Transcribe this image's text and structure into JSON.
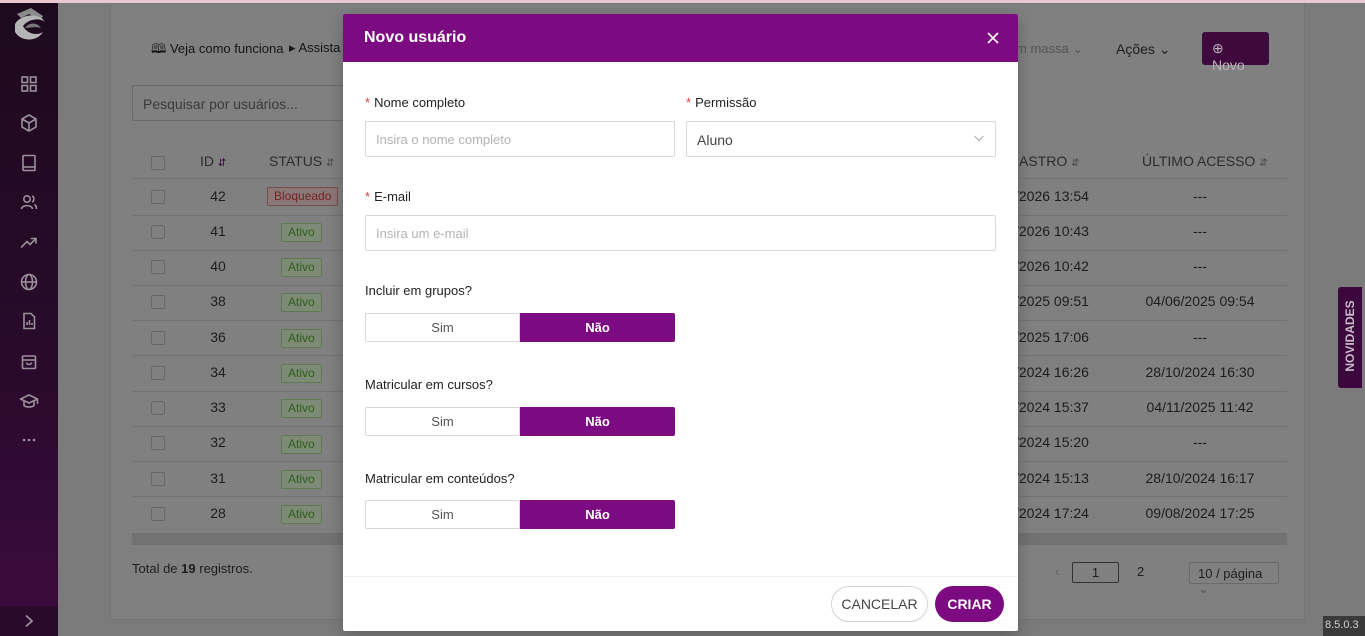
{
  "toolbar": {
    "how_it_works": "Veja como funciona",
    "assistant": "Assista",
    "bulk": "m massa",
    "actions": "Ações",
    "new_button": "Novo",
    "search_placeholder": "Pesquisar por usuários..."
  },
  "table": {
    "columns": [
      "ID",
      "STATUS",
      "ASTRO",
      "ÚLTIMO ACESSO"
    ],
    "rows": [
      {
        "id": "42",
        "status": "Bloqueado",
        "cadastro": "/2026 13:54",
        "last": "---"
      },
      {
        "id": "41",
        "status": "Ativo",
        "cadastro": "/2026 10:43",
        "last": "---"
      },
      {
        "id": "40",
        "status": "Ativo",
        "cadastro": "/2026 10:42",
        "last": "---"
      },
      {
        "id": "38",
        "status": "Ativo",
        "cadastro": "/2025 09:51",
        "last": "04/06/2025 09:54"
      },
      {
        "id": "36",
        "status": "Ativo",
        "cadastro": "/2025 17:06",
        "last": "---"
      },
      {
        "id": "34",
        "status": "Ativo",
        "cadastro": "/2024 16:26",
        "last": "28/10/2024 16:30"
      },
      {
        "id": "33",
        "status": "Ativo",
        "cadastro": "/2024 15:37",
        "last": "04/11/2025 11:42"
      },
      {
        "id": "32",
        "status": "Ativo",
        "cadastro": "/2024 15:20",
        "last": "---"
      },
      {
        "id": "31",
        "status": "Ativo",
        "cadastro": "/2024 15:13",
        "last": "28/10/2024 16:17"
      },
      {
        "id": "28",
        "status": "Ativo",
        "cadastro": "/2024 17:24",
        "last": "09/08/2024 17:25"
      }
    ]
  },
  "footer": {
    "total_prefix": "Total de ",
    "total_count": "19",
    "total_suffix": " registros.",
    "page_current": "1",
    "page_next": "2",
    "page_size": "10 / página"
  },
  "novidades": "NOVIDADES",
  "version": "8.5.0.3",
  "modal": {
    "title": "Novo usuário",
    "full_name_label": "Nome completo",
    "full_name_placeholder": "Insira o nome completo",
    "permission_label": "Permissão",
    "permission_value": "Aluno",
    "email_label": "E-mail",
    "email_placeholder": "Insira um e-mail",
    "groups_label": "Incluir em grupos?",
    "courses_label": "Matricular em cursos?",
    "contents_label": "Matricular em conteúdos?",
    "yes": "Sim",
    "no": "Não",
    "cancel": "CANCELAR",
    "create": "CRIAR"
  },
  "colors": {
    "accent": "#7c0b81",
    "sidebar": "#2a0a2c",
    "required": "#e03e3e"
  },
  "icons": [
    "logo-icon",
    "grid-icon",
    "cube-icon",
    "book-icon",
    "users-icon",
    "trend-icon",
    "globe-icon",
    "report-icon",
    "bag-icon",
    "graduation-icon",
    "more-icon",
    "chevron-right-icon",
    "close-icon",
    "chevron-down-icon",
    "plus-circle-icon"
  ]
}
